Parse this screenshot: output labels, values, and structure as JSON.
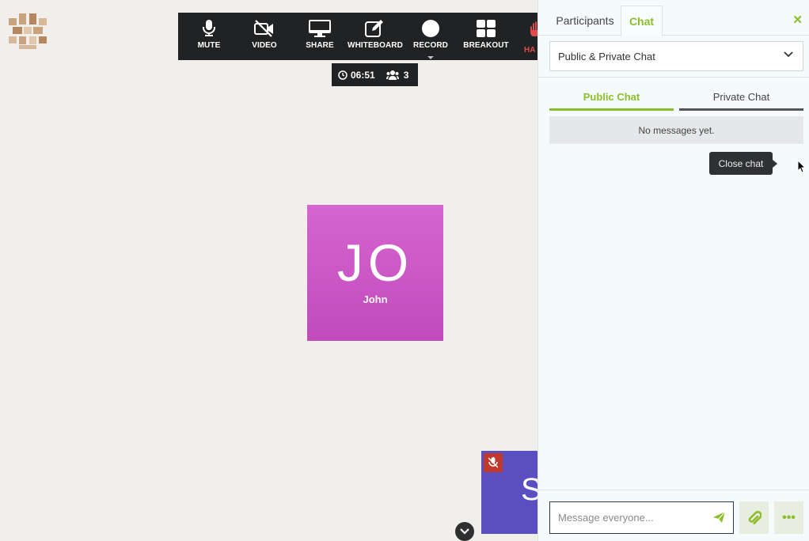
{
  "toolbar": {
    "mute_label": "MUTE",
    "video_label": "VIDEO",
    "share_label": "SHARE",
    "whiteboard_label": "WHITEBOARD",
    "record_label": "RECORD",
    "breakout_label": "BREAKOUT",
    "hand_label_partial": "HA"
  },
  "status": {
    "timer": "06:51",
    "participant_count": "3"
  },
  "video": {
    "main_tile_initials": "JO",
    "main_tile_name": "John",
    "main_tile_color": "#c955c5",
    "second_tile_initial": "S",
    "second_tile_color": "#5a4fc0"
  },
  "panel": {
    "tab_participants": "Participants",
    "tab_chat": "Chat",
    "close_icon": "close-icon",
    "chat_select_value": "Public & Private Chat",
    "subtab_public": "Public Chat",
    "subtab_private": "Private Chat",
    "empty_message": "No messages yet.",
    "tooltip": "Close chat",
    "message_placeholder": "Message everyone...",
    "accent_color": "#8cbd2b"
  }
}
